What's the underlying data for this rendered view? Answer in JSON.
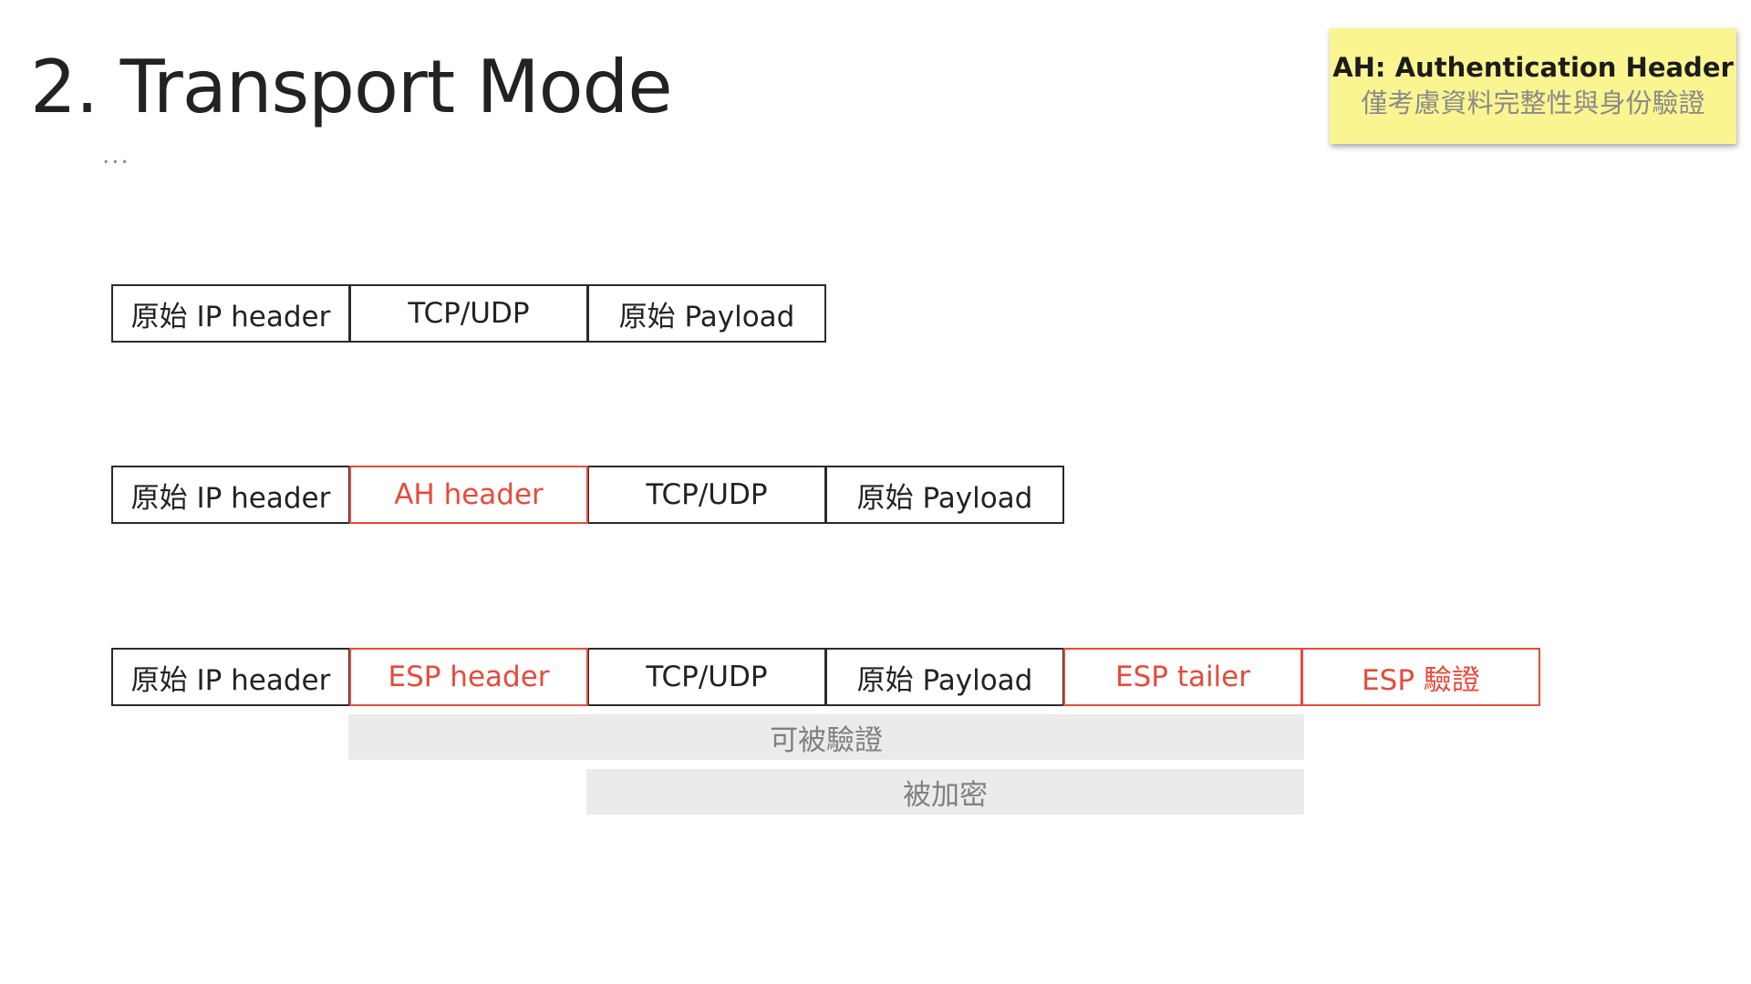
{
  "slide": {
    "title": "2. Transport Mode",
    "ellipsis": "..."
  },
  "note": {
    "title": "AH: Authentication Header",
    "subtitle": "僅考慮資料完整性與身份驗證",
    "background_color": "#fbf591"
  },
  "colors": {
    "accent": "#e84a3a",
    "border": "#2a2a2a",
    "bar_background": "#ebebeb",
    "bar_text": "#808080"
  },
  "rows": [
    {
      "fields": [
        {
          "label": "原始 IP header",
          "highlight": false
        },
        {
          "label": "TCP/UDP",
          "highlight": false
        },
        {
          "label": "原始 Payload",
          "highlight": false
        }
      ]
    },
    {
      "fields": [
        {
          "label": "原始 IP header",
          "highlight": false
        },
        {
          "label": "AH header",
          "highlight": true
        },
        {
          "label": "TCP/UDP",
          "highlight": false
        },
        {
          "label": "原始 Payload",
          "highlight": false
        }
      ]
    },
    {
      "fields": [
        {
          "label": "原始 IP header",
          "highlight": false
        },
        {
          "label": "ESP header",
          "highlight": true
        },
        {
          "label": "TCP/UDP",
          "highlight": false
        },
        {
          "label": "原始 Payload",
          "highlight": false
        },
        {
          "label": "ESP tailer",
          "highlight": true
        },
        {
          "label": "ESP 驗證",
          "highlight": true
        }
      ]
    }
  ],
  "bars": {
    "authenticated": "可被驗證",
    "encrypted": "被加密"
  }
}
